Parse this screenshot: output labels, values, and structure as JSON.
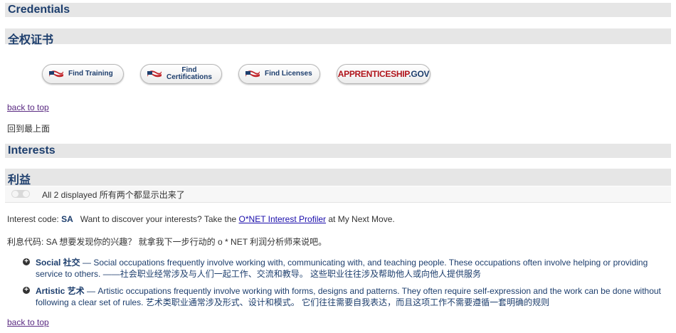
{
  "sections": {
    "credentials_en": "Credentials",
    "credentials_zh": "全权证书",
    "interests_en": "Interests",
    "interests_zh": "利益"
  },
  "buttons": {
    "find_training": "Find Training",
    "find_cert_line1": "Find",
    "find_cert_line2": "Certifications",
    "find_licenses": "Find Licenses",
    "apprenticeship_main": "APPRENTICESHIP",
    "apprenticeship_suffix": ".GOV"
  },
  "links": {
    "back_to_top": "back to top",
    "back_to_top_zh": "回到最上面"
  },
  "filter": {
    "text": "All 2 displayed 所有两个都显示出来了"
  },
  "interest_code": {
    "label": "Interest code:",
    "code": "SA",
    "prompt": "Want to discover your interests? Take the",
    "profiler_link": "O*NET Interest Profiler",
    "suffix": "at My Next Move.",
    "zh": "利息代码: SA 想要发现你的兴趣？ 就拿我下一步行动的 o * NET 利润分析师来说吧。"
  },
  "interests": [
    {
      "title": "Social 社交",
      "desc": " — Social occupations frequently involve working with, communicating with, and teaching people. These occupations often involve helping or providing service to others. ——社会职业经常涉及与人们一起工作、交流和教导。 这些职业往往涉及帮助他人或向他人提供服务"
    },
    {
      "title": "Artistic 艺术",
      "desc": " — Artistic occupations frequently involve working with forms, designs and patterns. They often require self-expression and the work can be done without following a clear set of rules. 艺术类职业通常涉及形式、设计和模式。 它们往往需要自我表达，而且这项工作不需要遵循一套明确的规则"
    }
  ],
  "colors": {
    "heading": "#1d3e6d",
    "section_bar": "#e6e6e6",
    "visited_link": "#5a2a82",
    "link": "#1a0dab",
    "apprenticeship_red": "#b0151c"
  }
}
